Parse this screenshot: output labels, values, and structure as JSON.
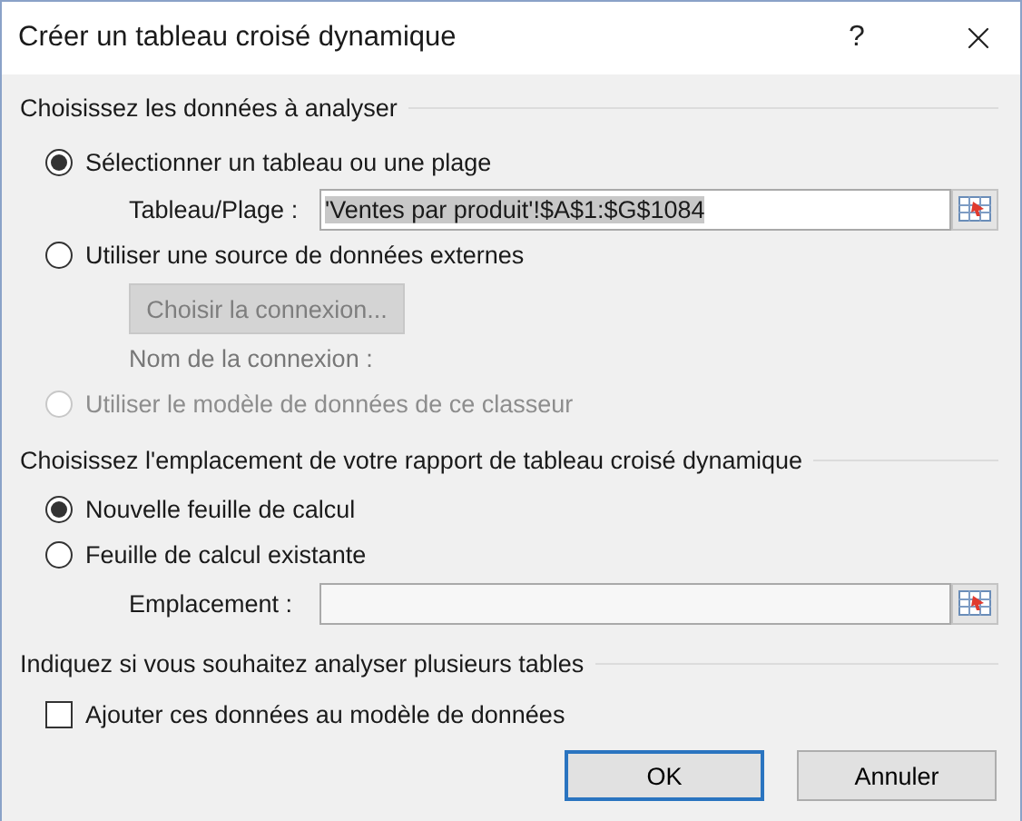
{
  "window": {
    "title": "Créer un tableau croisé dynamique",
    "help": "?"
  },
  "sections": [
    {
      "heading": "Choisissez les données à analyser",
      "items": [
        {
          "kind": "radio",
          "label": "Sélectionner un tableau ou une plage",
          "selected": true,
          "disabled": false
        },
        {
          "kind": "range",
          "label": "Tableau/Plage :",
          "value": "'Ventes par produit'!$A$1:$G$1084",
          "highlighted": true
        },
        {
          "kind": "radio",
          "label": "Utiliser une source de données externes",
          "selected": false,
          "disabled": false
        },
        {
          "kind": "button",
          "label": "Choisir la connexion...",
          "disabled": true
        },
        {
          "kind": "note",
          "label": "Nom de la connexion :"
        },
        {
          "kind": "radio",
          "label": "Utiliser le modèle de données de ce classeur",
          "selected": false,
          "disabled": true
        }
      ]
    },
    {
      "heading": "Choisissez l'emplacement de votre rapport de tableau croisé dynamique",
      "items": [
        {
          "kind": "radio",
          "label": "Nouvelle feuille de calcul",
          "selected": true,
          "disabled": false
        },
        {
          "kind": "radio",
          "label": "Feuille de calcul existante",
          "selected": false,
          "disabled": false
        },
        {
          "kind": "range",
          "label": "Emplacement :"
        }
      ]
    },
    {
      "heading": "Indiquez si vous souhaitez analyser plusieurs tables",
      "items": [
        {
          "kind": "checkbox",
          "label": "Ajouter ces données au modèle de données",
          "checked": false
        }
      ]
    }
  ],
  "buttons": [
    {
      "label": "OK",
      "default": true
    },
    {
      "label": "Annuler",
      "default": false
    }
  ]
}
